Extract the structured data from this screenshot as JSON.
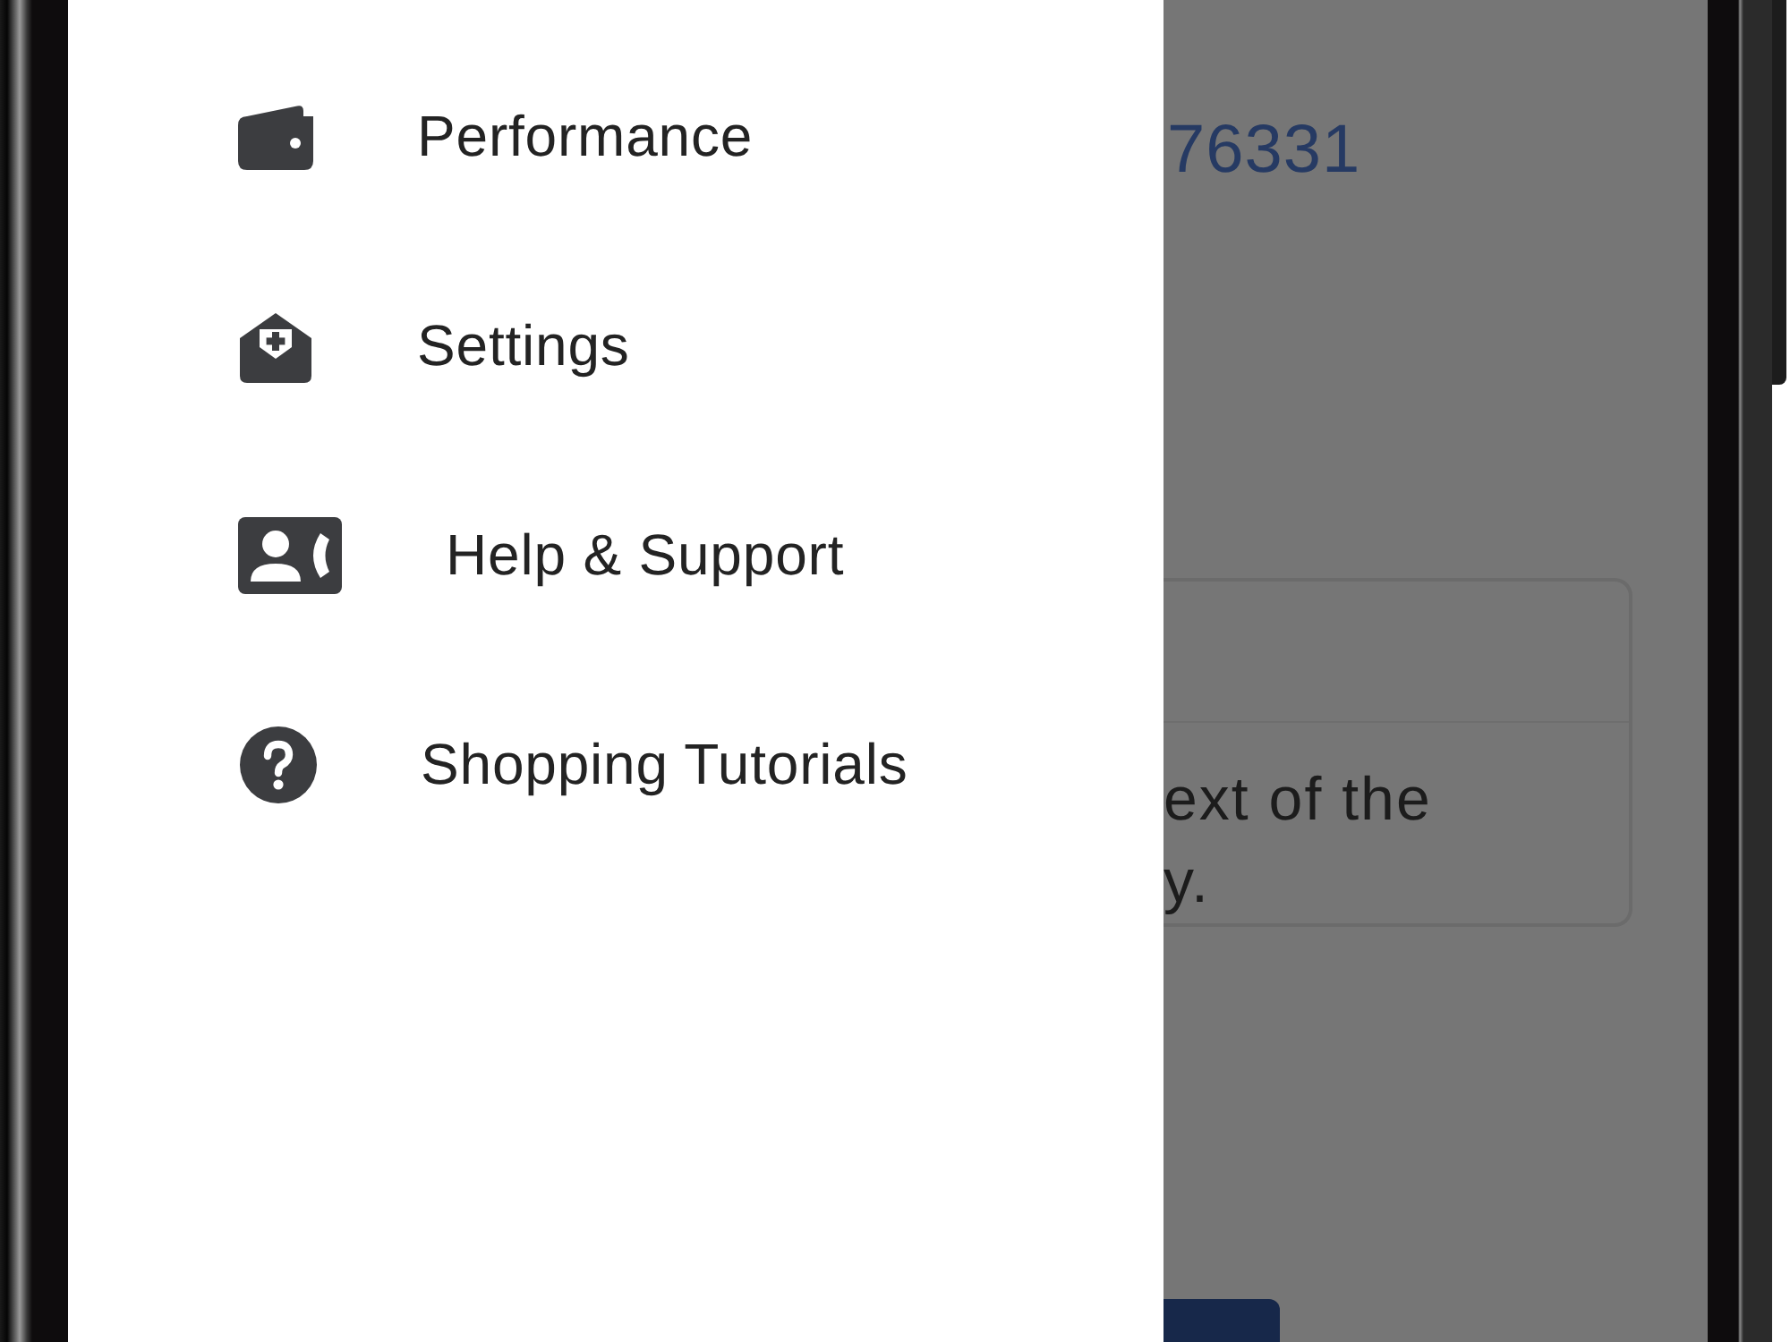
{
  "drawer": {
    "items": [
      {
        "label": "Performance"
      },
      {
        "label": "Settings"
      },
      {
        "label": "Help & Support"
      },
      {
        "label": "Shopping Tutorials"
      }
    ]
  },
  "background_page": {
    "number": "76331",
    "card": {
      "lines": [
        "ext of the",
        "y."
      ]
    }
  }
}
